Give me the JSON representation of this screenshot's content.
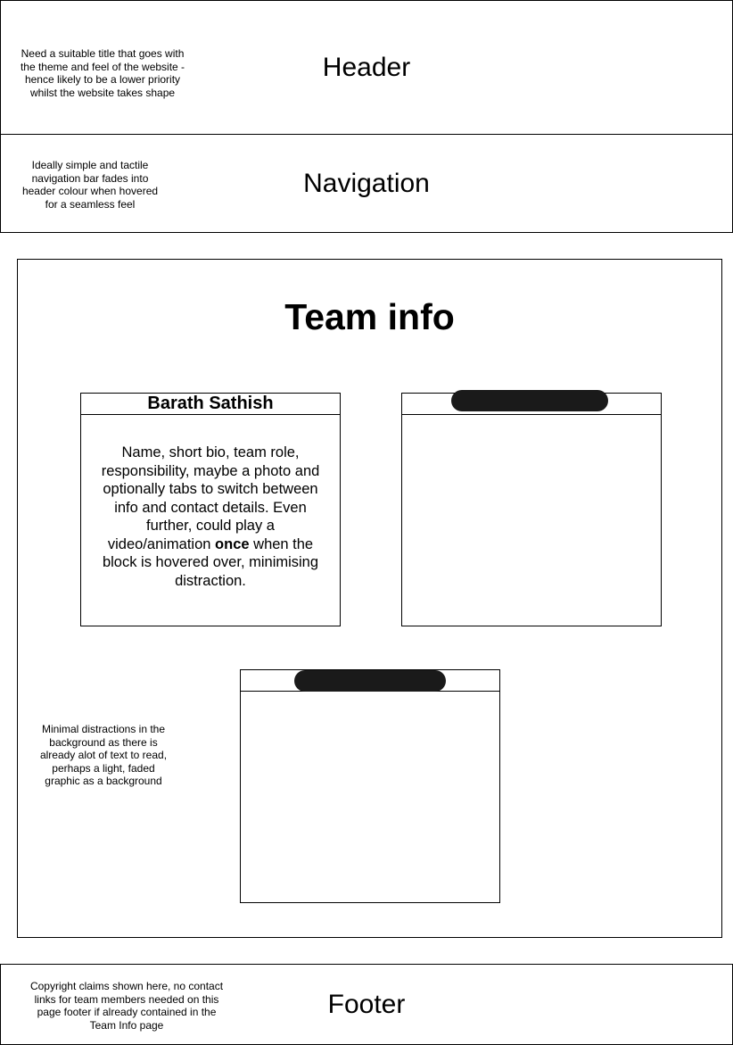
{
  "header": {
    "label": "Header",
    "note": "Need a suitable title that goes with the theme and feel of the website - hence likely to be a lower priority whilst the website takes shape"
  },
  "navigation": {
    "label": "Navigation",
    "note": "Ideally simple and tactile navigation bar fades into header colour when hovered for a seamless feel"
  },
  "main": {
    "title": "Team info",
    "background_note": "Minimal distractions in the background as there is already alot of text to read, perhaps a light, faded graphic as a background",
    "cards": [
      {
        "name": "Barath Sathish",
        "body_before": "Name, short bio, team role, responsibility, maybe a photo and optionally tabs to switch between info and contact details. Even further, could play a video/animation ",
        "body_bold": "once",
        "body_after": " when the block is hovered over, minimising distraction."
      },
      {
        "name": "",
        "redacted": true
      },
      {
        "name": "",
        "redacted": true
      }
    ]
  },
  "footer": {
    "label": "Footer",
    "note": "Copyright claims shown here, no contact links for team members needed on this page footer if already contained in the Team Info page"
  },
  "colors": {
    "line": "#000000",
    "redaction": "#1a1a1a",
    "background": "#ffffff"
  }
}
